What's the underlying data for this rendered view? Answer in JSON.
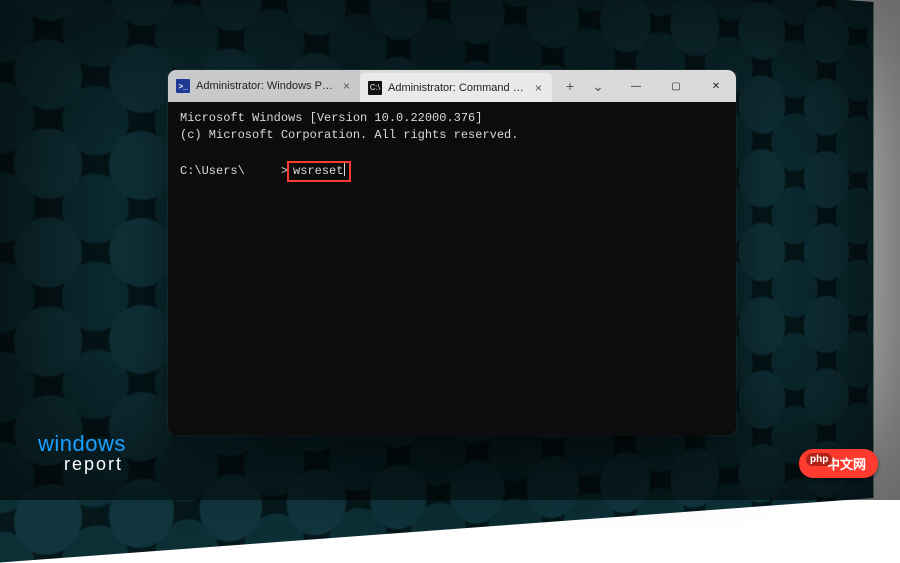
{
  "tabs": [
    {
      "label": "Administrator: Windows PowerS",
      "icon_name": "powershell-icon",
      "icon_text": ">_",
      "active": false
    },
    {
      "label": "Administrator: Command Promp",
      "icon_name": "cmd-icon",
      "icon_text": "C:\\",
      "active": true
    }
  ],
  "tabs_actions": {
    "new_tab": "+",
    "overflow": "⌄"
  },
  "window_controls": {
    "minimize": "—",
    "maximize": "▢",
    "close": "✕"
  },
  "terminal": {
    "line1": "Microsoft Windows [Version 10.0.22000.376]",
    "line2": "(c) Microsoft Corporation. All rights reserved.",
    "prompt_prefix": "C:\\Users\\",
    "prompt_username_redacted": "█████",
    "prompt_suffix": ">",
    "input_command": "wsreset"
  },
  "watermarks": {
    "windowsreport_line1": "windows",
    "windowsreport_line2": "report",
    "php_badge": "中文网"
  }
}
